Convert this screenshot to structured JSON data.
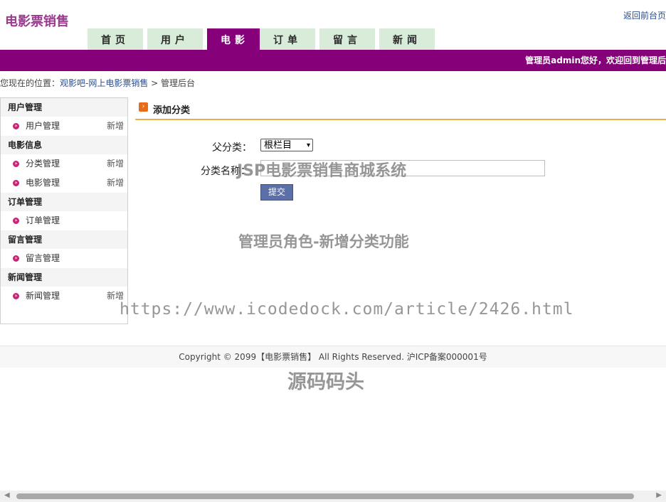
{
  "header": {
    "logo": "电影票销售",
    "back_link": "返回前台页",
    "welcome": "管理员admin您好，欢迎回到管理后"
  },
  "nav": {
    "tabs": [
      {
        "label": "首页"
      },
      {
        "label": "用户"
      },
      {
        "label": "电影",
        "active": true
      },
      {
        "label": "订单"
      },
      {
        "label": "留言"
      },
      {
        "label": "新闻"
      }
    ]
  },
  "breadcrumb": {
    "prefix": "您现在的位置：",
    "site": "观影吧-网上电影票销售",
    "separator": " > ",
    "current": "管理后台"
  },
  "sidebar": {
    "sections": [
      {
        "title": "用户管理",
        "items": [
          {
            "label": "用户管理",
            "add": "新增"
          }
        ]
      },
      {
        "title": "电影信息",
        "items": [
          {
            "label": "分类管理",
            "add": "新增"
          },
          {
            "label": "电影管理",
            "add": "新增"
          }
        ]
      },
      {
        "title": "订单管理",
        "items": [
          {
            "label": "订单管理",
            "add": ""
          }
        ]
      },
      {
        "title": "留言管理",
        "items": [
          {
            "label": "留言管理",
            "add": ""
          }
        ]
      },
      {
        "title": "新闻管理",
        "items": [
          {
            "label": "新闻管理",
            "add": "新增"
          }
        ]
      }
    ]
  },
  "content": {
    "title": "添加分类",
    "parent_label": "父分类：",
    "parent_value": "根栏目",
    "name_label": "分类名称：",
    "name_value": "",
    "submit_label": "提交"
  },
  "watermarks": {
    "w1": "JSP电影票销售商城系统",
    "w2": "管理员角色-新增分类功能",
    "w3": "https://www.icodedock.com/article/2426.html",
    "w4": "源码码头"
  },
  "footer": {
    "text": "Copyright © 2099【电影票销售】 All Rights Reserved. 沪ICP备案000001号"
  },
  "colors": {
    "brand_purple": "#86007a",
    "tab_green": "#d9ecd9",
    "accent_orange": "#e8b24e",
    "button_blue": "#5b6fa8"
  }
}
